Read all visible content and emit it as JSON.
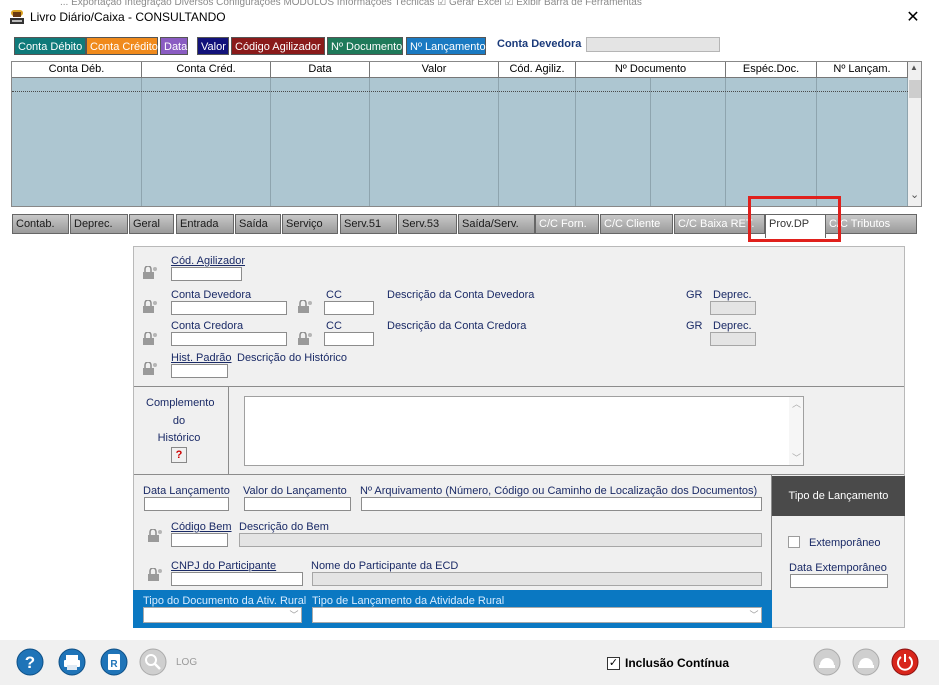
{
  "window": {
    "title": "Livro Diário/Caixa  -  CONSULTANDO",
    "close_glyph": "✕",
    "ghost_menu": "...    Exportação     Integração     Diversos     Configurações     MÓDULOS     Informações Técnicas    ☑ Gerar Excel   ☑ Exibir Barra de Ferramentas"
  },
  "order_tabs": [
    {
      "label": "Conta Débito",
      "bg": "#0f7a7a"
    },
    {
      "label": "Conta Crédito",
      "bg": "#f08a1c"
    },
    {
      "label": "Data",
      "bg": "#8a5cc2"
    },
    {
      "label": "Valor",
      "bg": "#12127a"
    },
    {
      "label": "Código Agilizador",
      "bg": "#8a1a1a"
    },
    {
      "label": "Nº Documento",
      "bg": "#1f7a5a"
    },
    {
      "label": "Nº Lançamento",
      "bg": "#1a7ac2"
    }
  ],
  "conta_devedora_label": "Conta Devedora",
  "grid": {
    "columns": [
      "Conta Déb.",
      "Conta Créd.",
      "Data",
      "Valor",
      "Cód. Agiliz.",
      "Nº Documento",
      "Espéc.Doc.",
      "Nº Lançam."
    ],
    "scroll_up": "▲",
    "scroll_down": "⌄"
  },
  "tabs": [
    "Contab.",
    "Deprec.",
    "Geral",
    "Entrada",
    "Saída",
    "Serviço",
    "Serv.51",
    "Serv.53",
    "Saída/Serv.",
    "C/C Forn.",
    "C/C Cliente",
    "C/C Baixa RET.",
    "Prov.DP",
    "C/C Tributos"
  ],
  "active_tab": "Prov.DP",
  "form": {
    "cod_agilizador": "Cód. Agilizador",
    "conta_devedora": "Conta Devedora",
    "cc1": "CC",
    "desc_devedora": "Descrição da Conta Devedora",
    "gr1": "GR",
    "deprec1": "Deprec.",
    "conta_credora": "Conta Credora",
    "cc2": "CC",
    "desc_credora": "Descrição da Conta Credora",
    "gr2": "GR",
    "deprec2": "Deprec.",
    "hist_padrao": "Hist. Padrão",
    "desc_historico": "Descrição do Histórico",
    "complemento_1": "Complemento",
    "complemento_2": "do",
    "complemento_3": "Histórico",
    "help_btn": "?",
    "data_lancamento": "Data Lançamento",
    "valor_lancamento": "Valor do Lançamento",
    "num_arquivamento": "Nº Arquivamento (Número, Código ou Caminho de Localização dos Documentos)",
    "codigo_bem": "Código Bem",
    "descricao_bem": "Descrição do Bem",
    "cnpj_participante": "CNPJ do Participante",
    "nome_participante": "Nome do Participante da ECD",
    "tipo_doc_rural": "Tipo do Documento da Ativ. Rural",
    "tipo_lanc_rural": "Tipo de Lançamento da Atividade Rural"
  },
  "tipo_lancamento": {
    "title": "Tipo de Lançamento",
    "extemporaneo": "Extemporâneo",
    "data_extemporaneo": "Data Extemporâneo"
  },
  "bottom": {
    "log_label": "LOG",
    "inclusao_continua": "Inclusão Contínua",
    "inclusao_checked": true
  }
}
